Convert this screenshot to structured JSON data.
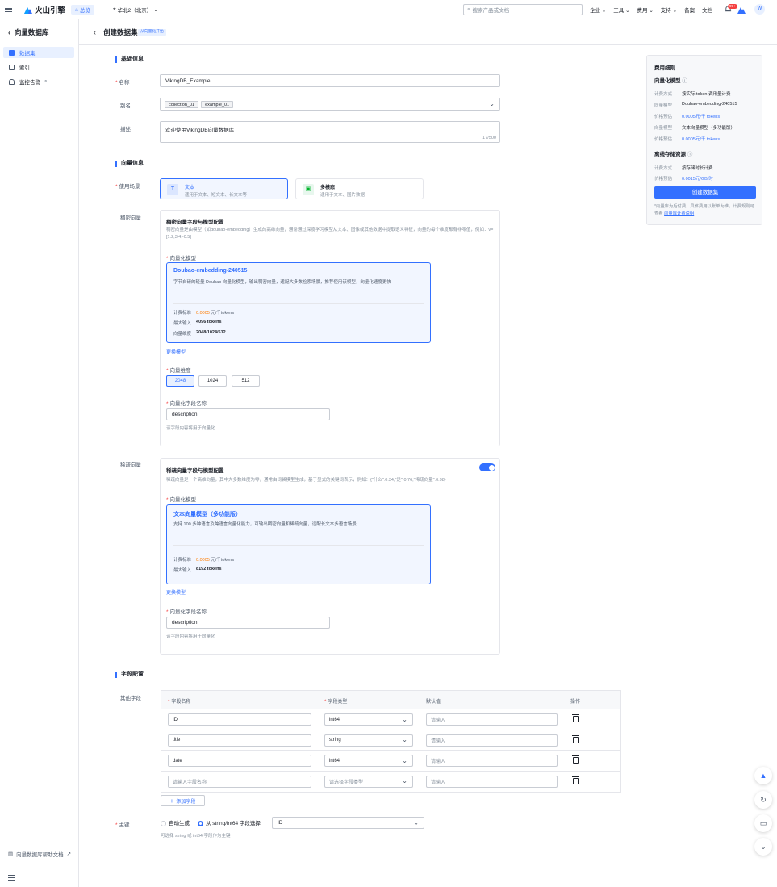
{
  "topbar": {
    "logo_text": "火山引擎",
    "home_label": "总览",
    "region": "华北2（北京）",
    "search_placeholder": "搜索产品或文档",
    "nav": [
      "企业",
      "工具",
      "费用",
      "支持",
      "备案",
      "文档"
    ],
    "badge": "99+",
    "avatar": "W"
  },
  "sidebar": {
    "title": "向量数据库",
    "items": [
      {
        "label": "数据集",
        "icon": "dataset-icon"
      },
      {
        "label": "索引",
        "icon": "index-icon"
      },
      {
        "label": "监控告警",
        "icon": "alarm-icon"
      }
    ],
    "help": "向量数据库帮助文档"
  },
  "header": {
    "title": "创建数据集",
    "tag": "从向量化开始"
  },
  "basic": {
    "section": "基础信息",
    "name_label": "名称",
    "name_value": "VikingDB_Example",
    "alias_label": "别名",
    "alias_tags": [
      "collection_01",
      "example_01"
    ],
    "desc_label": "描述",
    "desc_value": "欢迎使用VikingDB向量数据库",
    "desc_count": "17/500"
  },
  "vector": {
    "section": "向量信息",
    "scene_label": "使用场景",
    "scenes": [
      {
        "title": "文本",
        "desc": "适用于文本、短文本、长文本等",
        "icon": "T"
      },
      {
        "title": "多模态",
        "desc": "适用于文本、图片数据",
        "icon": "▣"
      }
    ],
    "dense": {
      "label": "稠密向量",
      "title": "稠密向量字段与模型配置",
      "desc": "稠密向量是由模型（如doubao-embedding）生成的高维向量，通常通过深度学习模型从文本、图像或其他数据中提取语义特征，向量的每个维度都有非零值，例如：v=[1.2,3.4,-0.5]",
      "model_label": "向量化模型",
      "model_name": "Doubao-embedding-240515",
      "model_desc": "字节自研的轻量 Doubao 向量化模型，输出稠密向量，适配大多数检索场景，推荐使用该模型，向量化速度更快",
      "price_key": "计费标准",
      "price_value": "0.0005",
      "price_unit": "元/千tokens",
      "max_key": "最大输入",
      "max_value": "4096 tokens",
      "dim_key": "向量维度",
      "dim_value": "2048/1024/512",
      "change_link": "更换模型",
      "dim_label": "向量维度",
      "dims": [
        "2048",
        "1024",
        "512"
      ],
      "field_label": "向量化字段名称",
      "field_value": "description",
      "field_hint": "该字段内容将用于向量化"
    },
    "sparse": {
      "label": "稀疏向量",
      "title": "稀疏向量字段与模型配置",
      "desc": "稀疏向量是一个高维向量，其中大多数维度为零，通常由词袋模型生成，基于显式的关键词表示，例如：{\"什么\":0.34,\"是\":0.76,\"稀疏向量\":0.98}",
      "model_label": "向量化模型",
      "model_name": "文本向量模型（多功能版）",
      "model_desc": "支持 100 多种语言及跨语言向量化能力，可输出稠密向量和稀疏向量，适配长文本多语言场景",
      "price_key": "计费标准",
      "price_value": "0.0005",
      "price_unit": "元/千tokens",
      "max_key": "最大输入",
      "max_value": "8192 tokens",
      "change_link": "更换模型",
      "field_label": "向量化字段名称",
      "field_value": "description",
      "field_hint": "该字段内容将用于向量化"
    }
  },
  "fields": {
    "section": "字段配置",
    "other_label": "其他字段",
    "headers": [
      "字段名称",
      "字段类型",
      "默认值",
      "操作"
    ],
    "rows": [
      {
        "name": "ID",
        "type": "int64",
        "default": "请输入"
      },
      {
        "name": "title",
        "type": "string",
        "default": "请输入"
      },
      {
        "name": "date",
        "type": "int64",
        "default": "请输入"
      },
      {
        "name": "请输入字段名称",
        "type": "请选择字段类型",
        "default": "请输入"
      }
    ],
    "add_label": "添加字段",
    "pk_label": "主键",
    "pk_auto": "自动生成",
    "pk_select": "从 string/int64 字段选择",
    "pk_value": "ID",
    "pk_hint": "可选择 string 或 int64 字段作为主键"
  },
  "cost": {
    "title": "费用细则",
    "embed_title": "向量化模型",
    "rows1": [
      {
        "k": "计费方式",
        "v": "按实际 token 调用量计费"
      },
      {
        "k": "向量模型",
        "v": "Doubao-embedding-240515"
      },
      {
        "k": "价格预估",
        "v": "0.0005元/千 tokens"
      },
      {
        "k": "向量模型",
        "v": "文本向量模型（多功能版）"
      },
      {
        "k": "价格预估",
        "v": "0.0005元/千 tokens"
      }
    ],
    "storage_title": "离线存储资源",
    "rows2": [
      {
        "k": "计费方式",
        "v": "按存储时长计费"
      },
      {
        "k": "价格预估",
        "v": "0.0015元/GB/时"
      }
    ],
    "button": "创建数据集",
    "note": "*向量库为后付费，具体费用以账单为准，计费规则可查看",
    "note_link": "向量库计费说明"
  },
  "colors": {
    "accent": "#3370ff",
    "required": "#f53f3f",
    "price": "#ff7d00"
  }
}
